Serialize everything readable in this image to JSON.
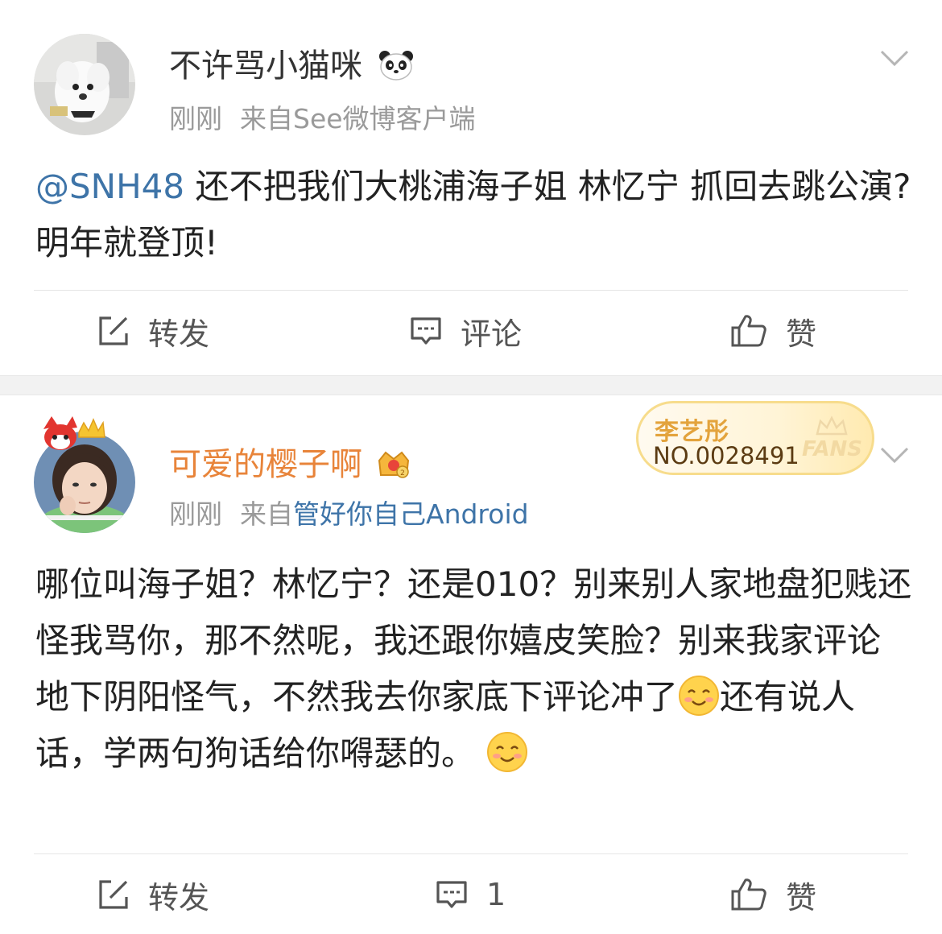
{
  "posts": [
    {
      "username": "不许骂小猫咪",
      "username_emoji": "panda-emoji",
      "time": "刚刚",
      "source_prefix": "来自",
      "source": "See微博客户端",
      "mention": "@SNH48",
      "text": " 还不把我们大桃浦海子姐 林忆宁 抓回去跳公演?明年就登顶!",
      "actions": {
        "repost": "转发",
        "comment": "评论",
        "like": "赞"
      }
    },
    {
      "username": "可爱的樱子啊",
      "username_color": "#e8843a",
      "username_badge": "crown-badge-icon",
      "time": "刚刚",
      "source_prefix": "来自",
      "source": "管好你自己Android",
      "fans_badge": {
        "name": "李艺彤",
        "number": "NO.0028491",
        "tag": "FANS"
      },
      "text_parts": [
        "哪位叫海子姐？林忆宁？还是010？别来别人家地盘犯贱还怪我骂你，那不然呢，我还跟你嬉皮笑脸？别来我家评论地下阴阳怪气，不然我去你家底下评论冲了",
        "还有说人话，学两句狗话给你嘚瑟的。"
      ],
      "inline_emoji": "smile-emoji",
      "actions": {
        "repost": "转发",
        "comment": "1",
        "like": "赞"
      }
    }
  ],
  "colors": {
    "link": "#3e74a8",
    "meta": "#9a9a9a",
    "separator": "#f2f2f2"
  }
}
